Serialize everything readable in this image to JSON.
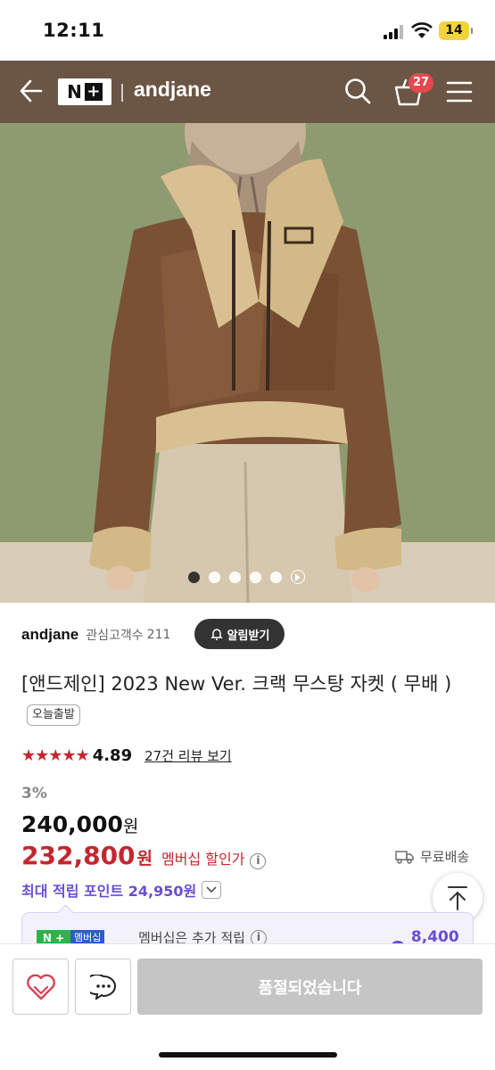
{
  "status_bar": {
    "time": "12:11",
    "battery": "14"
  },
  "header": {
    "store_name": "andjane",
    "cart_count": "27",
    "logo_text": "N"
  },
  "carousel": {
    "total": 5,
    "active_index": 0
  },
  "brand": {
    "name": "andjane",
    "follower_label": "관심고객수",
    "follower_count": "211",
    "alert_button": "알림받기"
  },
  "product": {
    "title": "[앤드제인] 2023 New Ver. 크랙 무스탕 자켓 ( 무배 )",
    "today_badge": "오늘출발",
    "rating": "4.89",
    "review_link": "27건 리뷰 보기",
    "discount": "3%",
    "original_price": "240,000",
    "currency": "원",
    "member_price": "232,800",
    "member_price_label": "멤버십 할인가",
    "shipping": "무료배송",
    "points_label": "최대 적립 포인트 24,950원"
  },
  "membership": {
    "badge": "멤버십",
    "text": "멤버십은 추가 적립",
    "points": "8,400원"
  },
  "bottom": {
    "soldout_label": "품절되었습니다"
  },
  "colors": {
    "header_bg": "#6b5545",
    "accent_red": "#c4262f",
    "accent_purple": "#6a4ed0"
  }
}
